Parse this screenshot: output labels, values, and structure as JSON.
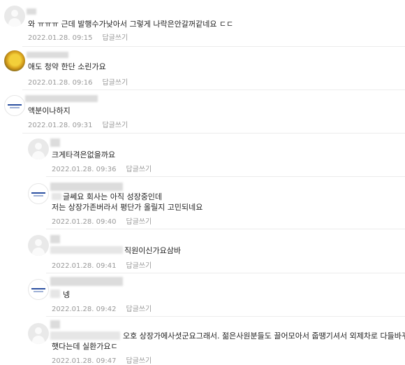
{
  "comments": [
    {
      "text": "와 ㅠㅠㅠ 근데 발행수가낮아서 그렇게 나락은안갈꺼같네요 ㄷㄷ",
      "date": "2022.01.28. 09:15",
      "reply": "답글쓰기",
      "avatar": "default-profile-icon"
    },
    {
      "text": "애도 청약 한단 소린가요",
      "date": "2022.01.28. 09:16",
      "reply": "답글쓰기",
      "avatar": "flower-avatar"
    },
    {
      "text": "액분이나하지",
      "date": "2022.01.28. 09:31",
      "reply": "답글쓰기",
      "avatar": "company-logo-avatar"
    },
    {
      "text": "크게타격은없을까요",
      "date": "2022.01.28. 09:36",
      "reply": "답글쓰기",
      "avatar": "default-profile-icon"
    },
    {
      "line1": "글쎄요 회사는 아직 성장중인데",
      "line2": "저는 상장가존버라서 평단가 올릴지 고민되네요",
      "date": "2022.01.28. 09:40",
      "reply": "답글쓰기",
      "avatar": "company-logo-avatar"
    },
    {
      "text": "직원이신가요삼바",
      "date": "2022.01.28. 09:41",
      "reply": "답글쓰기",
      "avatar": "default-profile-icon"
    },
    {
      "text": "넹",
      "date": "2022.01.28. 09:42",
      "reply": "답글쓰기",
      "avatar": "company-logo-avatar"
    },
    {
      "line1": "오호 상장가에사셧군요그래서. 젊은사원분들도 끌어모아서 줍땡기셔서 외제차로 다들바꾸고",
      "line2": "햇다는데 실환가요ㄷ",
      "date": "2022.01.28. 09:47",
      "reply": "답글쓰기",
      "avatar": "default-profile-icon"
    }
  ]
}
